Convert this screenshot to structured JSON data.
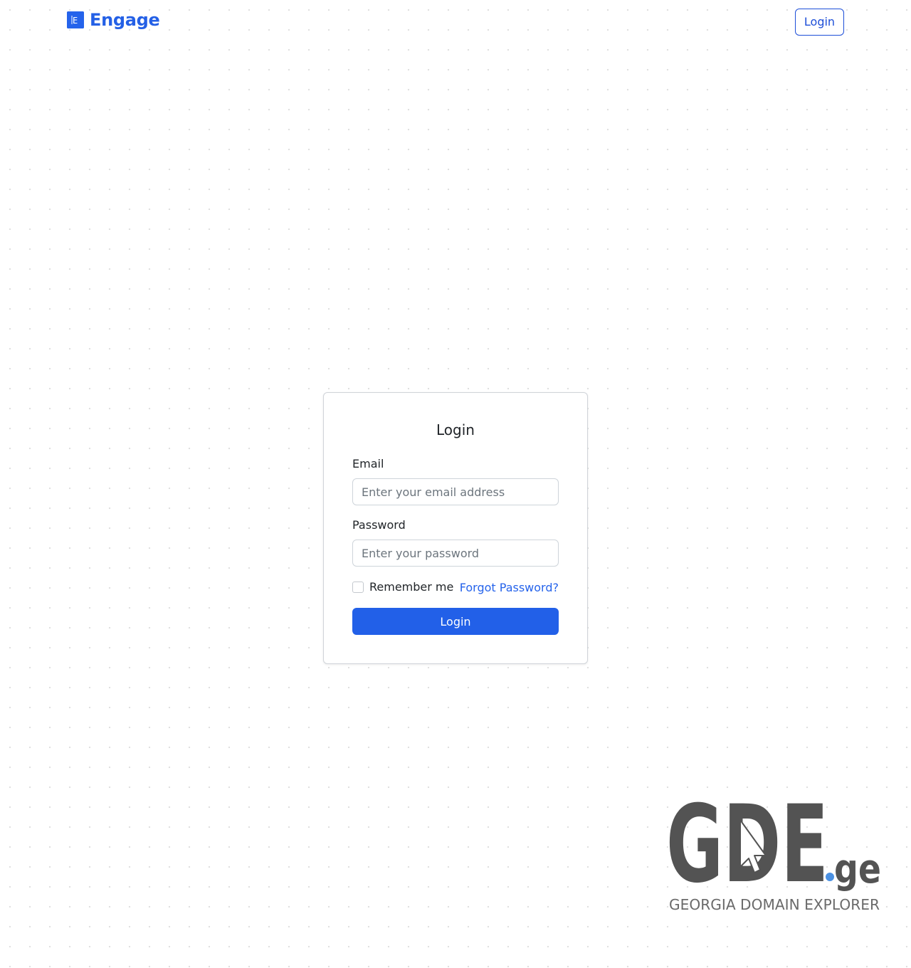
{
  "header": {
    "brand_name": "Engage",
    "brand_letter": "E",
    "login_label": "Login"
  },
  "login_form": {
    "title": "Login",
    "email_label": "Email",
    "email_placeholder": "Enter your email address",
    "password_label": "Password",
    "password_placeholder": "Enter your password",
    "remember_label": "Remember me",
    "forgot_label": "Forgot Password?",
    "submit_label": "Login"
  },
  "partner_logo": {
    "mark": "GDE",
    "suffix": ".ge",
    "tagline": "GEORGIA DOMAIN EXPLORER"
  },
  "colors": {
    "primary": "#2563eb",
    "logo_gray": "#535353",
    "logo_dot": "#4a90e2"
  },
  "icons": {
    "brand": "engage-logo-icon",
    "cursor": "cursor-arrow-icon"
  }
}
